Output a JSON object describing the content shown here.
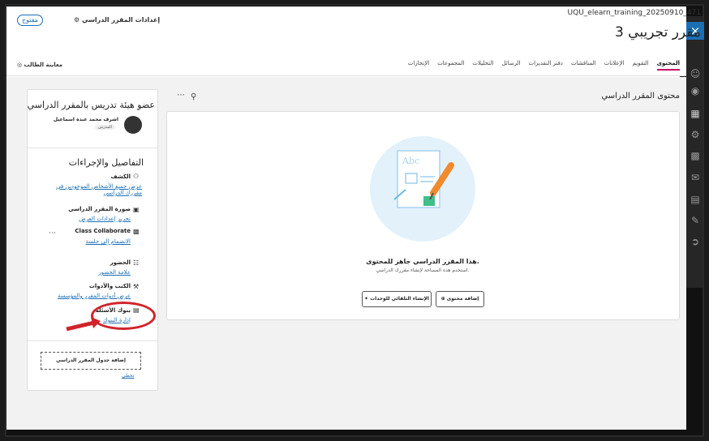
{
  "header": {
    "course_id": "UQU_elearn_training_20250910_471",
    "course_title": "مقرر تجريبي 3",
    "settings_label": "إعدادات المقرر الدراسي",
    "open_badge": "مفتوح",
    "close_icon": "×"
  },
  "nav": {
    "tabs": [
      "المحتوى",
      "التقويم",
      "الإعلانات",
      "المناقشات",
      "دفتر التقديرات",
      "الرسائل",
      "التحليلات",
      "المجموعات",
      "الإنجازات"
    ],
    "active_index": 0,
    "student_preview": "معاينة الطالب"
  },
  "content": {
    "title": "محتوى المقرر الدراسي",
    "ready_title": "هذا المقرر الدراسي جاهز للمحتوى.",
    "ready_sub": "استخدم هذه المساحة لإنشاء مقررك الدراسي.",
    "add_content_btn": "إضافة محتوى",
    "auto_gen_btn": "الإنشاء التلقائي للوحدات",
    "illus_text": "Abc"
  },
  "sidebar": {
    "instructor_heading": "عضو هيئة تدريس بالمقرر الدراسي",
    "instructor_name": "اشرف محمد عبده اسماعيل",
    "instructor_role": "المدرس",
    "details_heading": "التفاصيل والإجراءات",
    "items": [
      {
        "title": "الكشف",
        "link": "عرض جميع الأشخاص الموجودين في مقررك الدراسي"
      },
      {
        "title": "صورة المقرر الدراسي",
        "link": "تحرير إعدادات العرض"
      },
      {
        "title": "Class Collaborate",
        "link": "الانضمام إلى جلسة"
      },
      {
        "title": "الحضور",
        "link": "علامة الحضور"
      },
      {
        "title": "الكتب والأدوات",
        "link": "عرض أدوات المقرر والمؤسسة"
      },
      {
        "title": "بنوك الأسئلة",
        "link": "إدارة البنوك"
      }
    ],
    "schedule_btn": "إضافة جدول المقرر الدراسي",
    "skip_link": "تخطي"
  }
}
